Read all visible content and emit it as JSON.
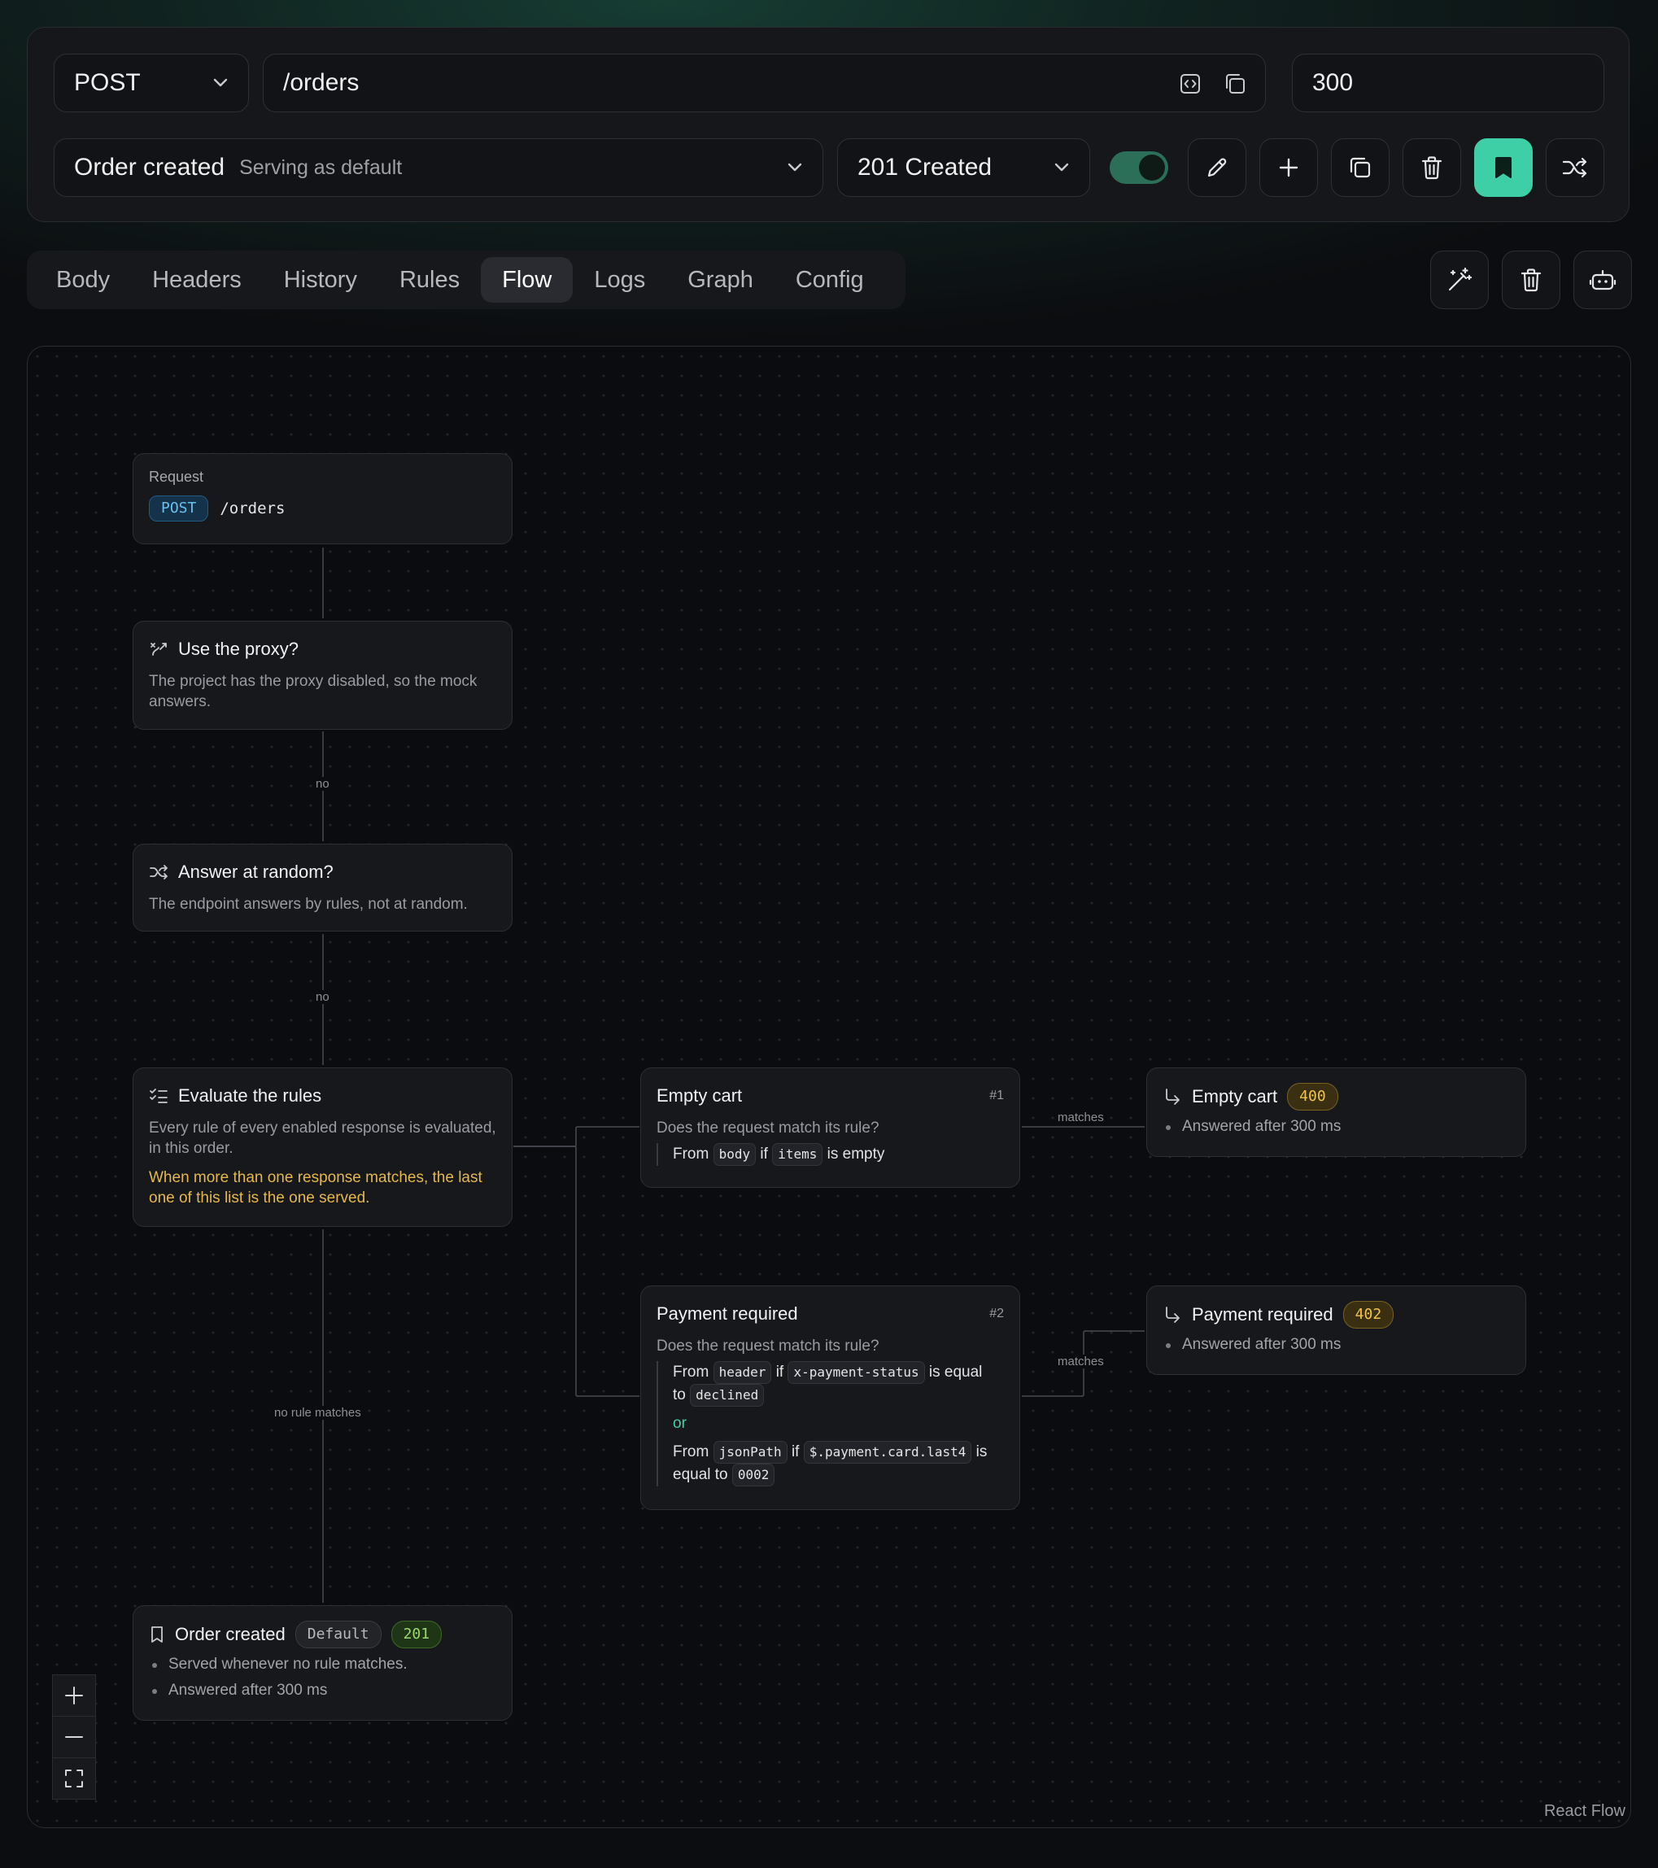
{
  "endpoint": {
    "method": "POST",
    "path": "/orders",
    "delay": "300",
    "response_name": "Order created",
    "response_status_text": "Serving as default",
    "status_code": "201 Created"
  },
  "tabs": [
    "Body",
    "Headers",
    "History",
    "Rules",
    "Flow",
    "Logs",
    "Graph",
    "Config"
  ],
  "active_tab": "Flow",
  "flow": {
    "request": {
      "label": "Request",
      "method": "POST",
      "path": "/orders"
    },
    "proxy": {
      "title": "Use the proxy?",
      "desc": "The project has the proxy disabled, so the mock answers."
    },
    "random": {
      "title": "Answer at random?",
      "desc": "The endpoint answers by rules, not at random."
    },
    "evaluate": {
      "title": "Evaluate the rules",
      "desc": "Every rule of every enabled response is evaluated, in this order.",
      "warning": "When more than one response matches, the last one of this list is the one served."
    },
    "edge_no_1": "no",
    "edge_no_2": "no",
    "edge_no_rule": "no rule matches",
    "edge_matches_1": "matches",
    "edge_matches_2": "matches",
    "rule1": {
      "title": "Empty cart",
      "index": "#1",
      "question": "Does the request match its rule?",
      "from": "From",
      "source": "body",
      "if": "if",
      "target": "items",
      "op": "is empty"
    },
    "rule2": {
      "title": "Payment required",
      "index": "#2",
      "question": "Does the request match its rule?",
      "c1_from": "From",
      "c1_source": "header",
      "c1_if": "if",
      "c1_target": "x-payment-status",
      "c1_op_a": "is equal",
      "c1_op_b": "to",
      "c1_value": "declined",
      "or": "or",
      "c2_from": "From",
      "c2_source": "jsonPath",
      "c2_if": "if",
      "c2_target": "$.payment.card.last4",
      "c2_op_a": "is",
      "c2_op_b": "equal to",
      "c2_value": "0002"
    },
    "result1": {
      "title": "Empty cart",
      "status": "400",
      "detail": "Answered after 300 ms"
    },
    "result2": {
      "title": "Payment required",
      "status": "402",
      "detail": "Answered after 300 ms"
    },
    "default": {
      "title": "Order created",
      "tag": "Default",
      "status": "201",
      "detail1": "Served whenever no rule matches.",
      "detail2": "Answered after 300 ms"
    },
    "attribution": "React Flow"
  },
  "colors": {
    "accent": "#3ecfa7",
    "warning": "#e5b84e",
    "toggle": "#2b6f58"
  }
}
